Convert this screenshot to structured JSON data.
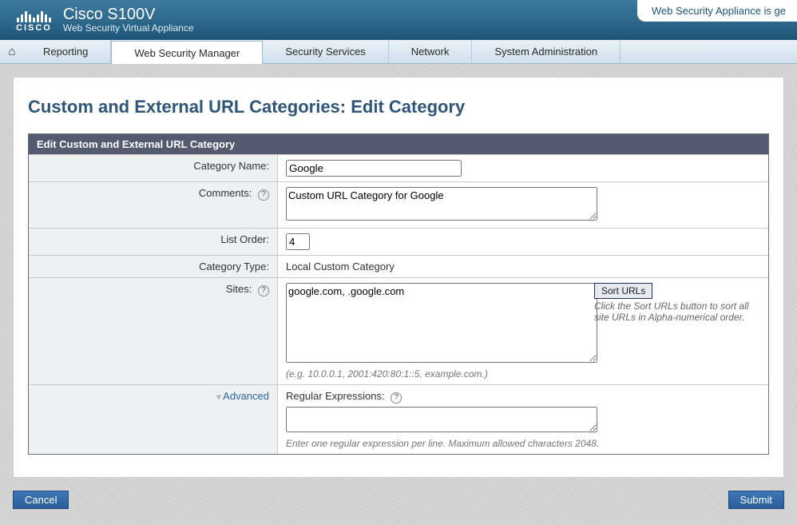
{
  "header": {
    "brand_word": "CISCO",
    "product_name": "Cisco S100V",
    "product_sub": "Web Security Virtual Appliance",
    "warning_text": "Web Security Appliance is ge"
  },
  "nav": {
    "tabs": [
      {
        "label": "Reporting"
      },
      {
        "label": "Web Security Manager"
      },
      {
        "label": "Security Services"
      },
      {
        "label": "Network"
      },
      {
        "label": "System Administration"
      }
    ],
    "active_index": 1
  },
  "page": {
    "title": "Custom and External URL Categories: Edit Category",
    "panel_title": "Edit Custom and External URL Category"
  },
  "form": {
    "category_name": {
      "label": "Category Name:",
      "value": "Google"
    },
    "comments": {
      "label": "Comments:",
      "value": "Custom URL Category for Google"
    },
    "list_order": {
      "label": "List Order:",
      "value": "4"
    },
    "category_type": {
      "label": "Category Type:",
      "value": "Local Custom Category"
    },
    "sites": {
      "label": "Sites:",
      "value": "google.com, .google.com",
      "example": "(e.g. 10.0.0.1, 2001:420:80:1::5, example.com.)",
      "sort_button": "Sort URLs",
      "sort_desc": "Click the Sort URLs button to sort all site URLs in Alpha-numerical order."
    },
    "advanced": {
      "toggle_label": "Advanced",
      "regex_label": "Regular Expressions:",
      "regex_value": "",
      "regex_hint": "Enter one regular expression per line. Maximum allowed characters 2048."
    }
  },
  "buttons": {
    "cancel": "Cancel",
    "submit": "Submit"
  }
}
